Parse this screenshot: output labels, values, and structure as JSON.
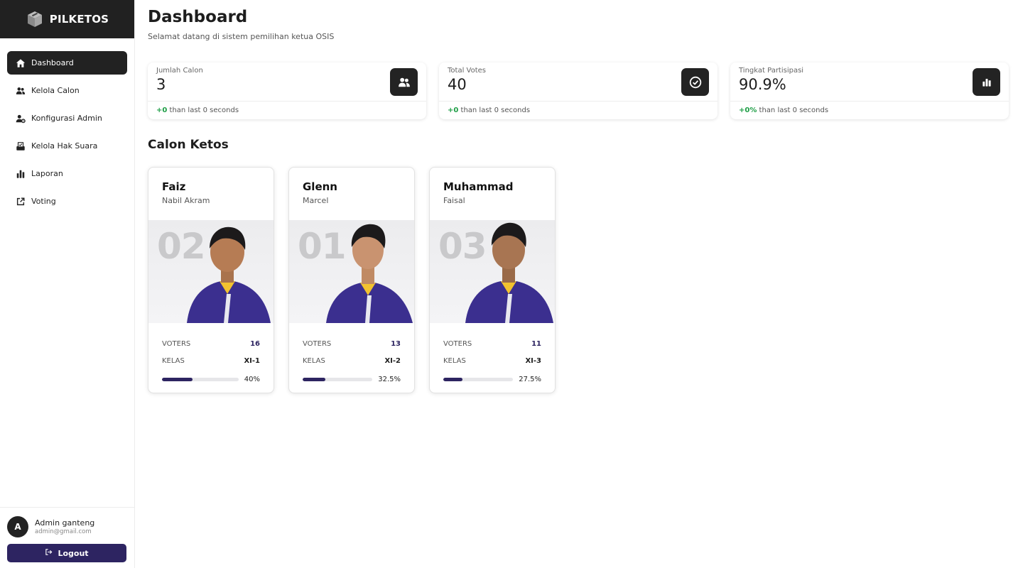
{
  "brand": {
    "name": "PILKETOS"
  },
  "sidebar": {
    "items": [
      {
        "label": "Dashboard",
        "icon": "home-icon",
        "active": true
      },
      {
        "label": "Kelola Calon",
        "icon": "users-icon",
        "active": false
      },
      {
        "label": "Konfigurasi Admin",
        "icon": "user-gear-icon",
        "active": false
      },
      {
        "label": "Kelola Hak Suara",
        "icon": "ballot-box-icon",
        "active": false
      },
      {
        "label": "Laporan",
        "icon": "bar-chart-icon",
        "active": false
      },
      {
        "label": "Voting",
        "icon": "external-link-icon",
        "active": false
      }
    ],
    "user": {
      "initial": "A",
      "name": "Admin ganteng",
      "email": "admin@gmail.com"
    },
    "logout_label": "Logout"
  },
  "header": {
    "title": "Dashboard",
    "subtitle": "Selamat datang di sistem pemilihan ketua OSIS"
  },
  "stats": [
    {
      "label": "Jumlah Calon",
      "value": "3",
      "delta": "+0",
      "foot": " than last 0 seconds",
      "icon": "users-icon"
    },
    {
      "label": "Total Votes",
      "value": "40",
      "delta": "+0",
      "foot": " than last 0 seconds",
      "icon": "check-circle-icon"
    },
    {
      "label": "Tingkat Partisipasi",
      "value": "90.9%",
      "delta": "+0%",
      "foot": " than last 0 seconds",
      "icon": "bar-chart-icon"
    }
  ],
  "section_title": "Calon Ketos",
  "candidates": [
    {
      "first_name": "Faiz",
      "last_name": "Nabil Akram",
      "number": "02",
      "voters_label": "VOTERS",
      "voters": "16",
      "kelas_label": "KELAS",
      "kelas": "XI-1",
      "percent_label": "40%",
      "percent": 0.4
    },
    {
      "first_name": "Glenn",
      "last_name": "Marcel",
      "number": "01",
      "voters_label": "VOTERS",
      "voters": "13",
      "kelas_label": "KELAS",
      "kelas": "XI-2",
      "percent_label": "32.5%",
      "percent": 0.325
    },
    {
      "first_name": "Muhammad",
      "last_name": "Faisal",
      "number": "03",
      "voters_label": "VOTERS",
      "voters": "11",
      "kelas_label": "KELAS",
      "kelas": "XI-3",
      "percent_label": "27.5%",
      "percent": 0.275
    }
  ],
  "colors": {
    "brand_dark": "#212121",
    "accent": "#2d2461",
    "positive": "#1e9e46"
  }
}
